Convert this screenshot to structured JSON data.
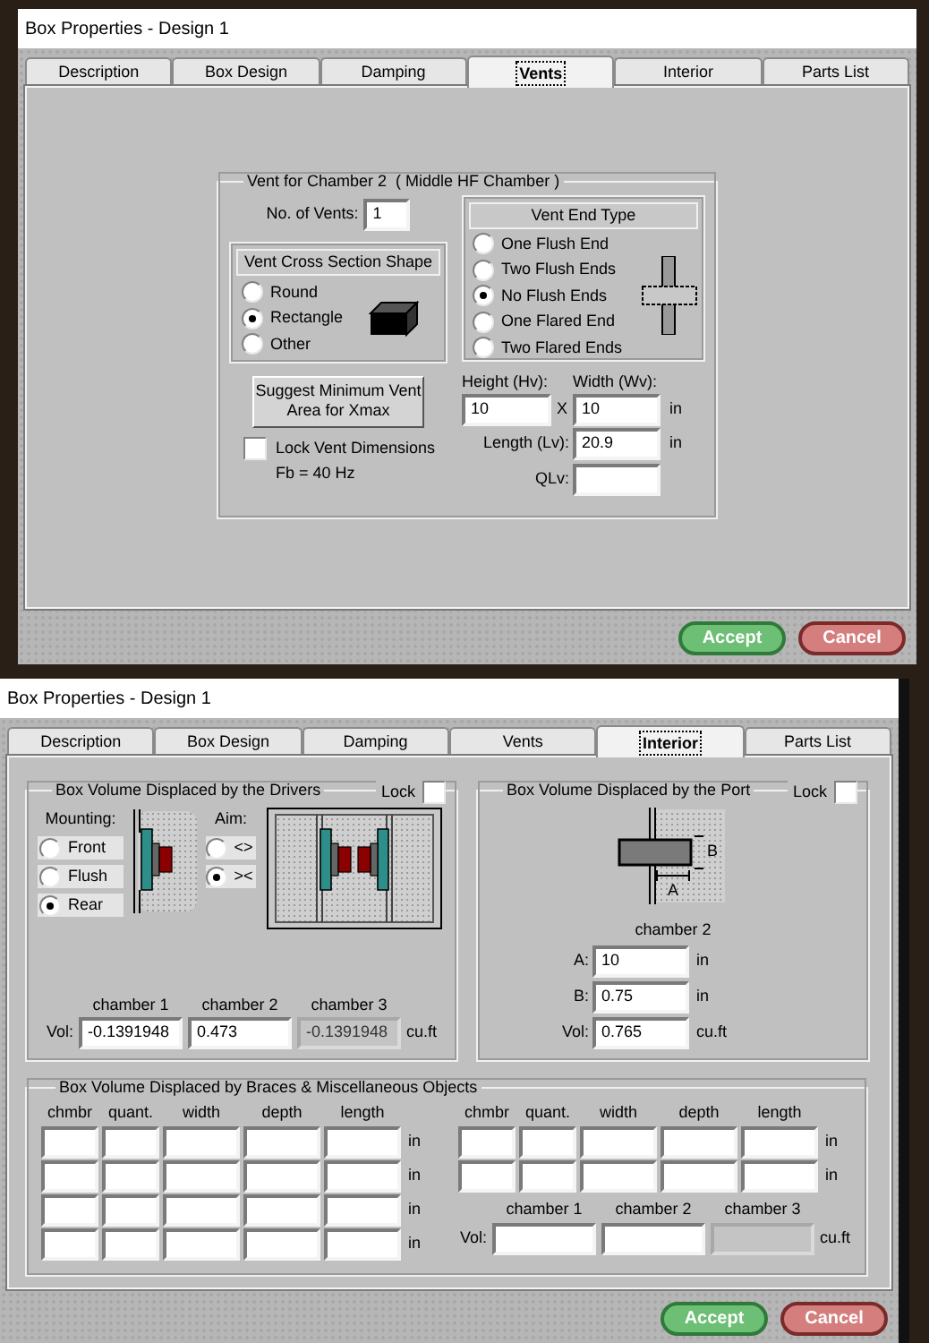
{
  "vents_window": {
    "title": "Box Properties - Design 1",
    "tabs": [
      {
        "label": "Description",
        "selected": false
      },
      {
        "label": "Box Design",
        "selected": false
      },
      {
        "label": "Damping",
        "selected": false
      },
      {
        "label": "Vents",
        "selected": true
      },
      {
        "label": "Interior",
        "selected": false
      },
      {
        "label": "Parts List",
        "selected": false
      }
    ],
    "vent_group": {
      "title": "Vent for Chamber 2  ( Middle HF Chamber )",
      "no_of_vents": {
        "label": "No. of Vents:",
        "value": "1"
      },
      "cross_section": {
        "title": "Vent Cross Section Shape",
        "options": [
          {
            "label": "Round",
            "selected": false
          },
          {
            "label": "Rectangle",
            "selected": true
          },
          {
            "label": "Other",
            "selected": false
          }
        ]
      },
      "end_type": {
        "title": "Vent End Type",
        "options": [
          {
            "label": "One Flush End",
            "selected": false
          },
          {
            "label": "Two Flush Ends",
            "selected": false
          },
          {
            "label": "No Flush Ends",
            "selected": true
          },
          {
            "label": "One Flared End",
            "selected": false
          },
          {
            "label": "Two Flared Ends",
            "selected": false
          }
        ]
      },
      "suggest_button": "Suggest Minimum Vent Area for Xmax",
      "lock": {
        "label": "Lock Vent Dimensions",
        "checked": false
      },
      "fb": "Fb = 40 Hz",
      "height": {
        "label": "Height (Hv):",
        "value": "10"
      },
      "times": "X",
      "width": {
        "label": "Width (Wv):",
        "value": "10",
        "unit": "in"
      },
      "length": {
        "label": "Length (Lv):",
        "value": "20.9",
        "unit": "in"
      },
      "qlv": {
        "label": "QLv:"
      }
    },
    "buttons": [
      {
        "label": "Accept",
        "kind": "accept"
      },
      {
        "label": "Cancel",
        "kind": "cancel"
      }
    ]
  },
  "interior_window": {
    "title": "Box Properties - Design 1",
    "tabs": [
      {
        "label": "Description",
        "selected": false
      },
      {
        "label": "Box Design",
        "selected": false
      },
      {
        "label": "Damping",
        "selected": false
      },
      {
        "label": "Vents",
        "selected": false
      },
      {
        "label": "Interior",
        "selected": true
      },
      {
        "label": "Parts List",
        "selected": false
      }
    ],
    "drivers_group": {
      "title": "Box Volume Displaced by the Drivers",
      "lock": {
        "label": "Lock",
        "checked": false
      },
      "mounting": {
        "label": "Mounting:",
        "options": [
          {
            "label": "Front",
            "selected": false
          },
          {
            "label": "Flush",
            "selected": false
          },
          {
            "label": "Rear",
            "selected": true
          }
        ]
      },
      "aim": {
        "label": "Aim:",
        "options": [
          {
            "label": "<>",
            "selected": false
          },
          {
            "label": "><",
            "selected": true
          }
        ]
      },
      "vol": {
        "label": "Vol:",
        "headers": [
          "chamber 1",
          "chamber 2",
          "chamber 3"
        ],
        "fields": [
          {
            "value": "-0.1391948",
            "disabled": false
          },
          {
            "value": "0.473",
            "disabled": false
          },
          {
            "value": "-0.1391948",
            "disabled": true
          }
        ],
        "unit": "cu.ft"
      }
    },
    "port_group": {
      "title": "Box Volume Displaced by the Port",
      "lock": {
        "label": "Lock",
        "checked": false
      },
      "dimension_labels": [
        "B",
        "A"
      ],
      "chamber": "chamber 2",
      "fields": [
        {
          "label": "A:",
          "value": "10",
          "unit": "in"
        },
        {
          "label": "B:",
          "value": "0.75",
          "unit": "in"
        },
        {
          "label": "Vol:",
          "value": "0.765",
          "unit": "cu.ft"
        }
      ]
    },
    "braces_group": {
      "title": "Box Volume Displaced by Braces & Miscellaneous Objects",
      "left_table": {
        "columns": [
          "chmbr",
          "quant.",
          "width",
          "depth",
          "length"
        ],
        "rows": [
          {
            "unit": "in"
          },
          {
            "unit": "in"
          },
          {
            "unit": "in"
          },
          {
            "unit": "in"
          }
        ]
      },
      "right_table": {
        "columns": [
          "chmbr",
          "quant.",
          "width",
          "depth",
          "length"
        ],
        "rows": [
          {
            "unit": "in"
          },
          {
            "unit": "in"
          }
        ]
      },
      "vol": {
        "label": "Vol:",
        "headers": [
          "chamber 1",
          "chamber 2",
          "chamber 3"
        ],
        "fields": [
          {
            "disabled": false
          },
          {
            "disabled": false
          },
          {
            "disabled": true
          }
        ],
        "unit": "cu.ft"
      }
    },
    "buttons": [
      {
        "label": "Accept",
        "kind": "accept"
      },
      {
        "label": "Cancel",
        "kind": "cancel"
      }
    ]
  }
}
